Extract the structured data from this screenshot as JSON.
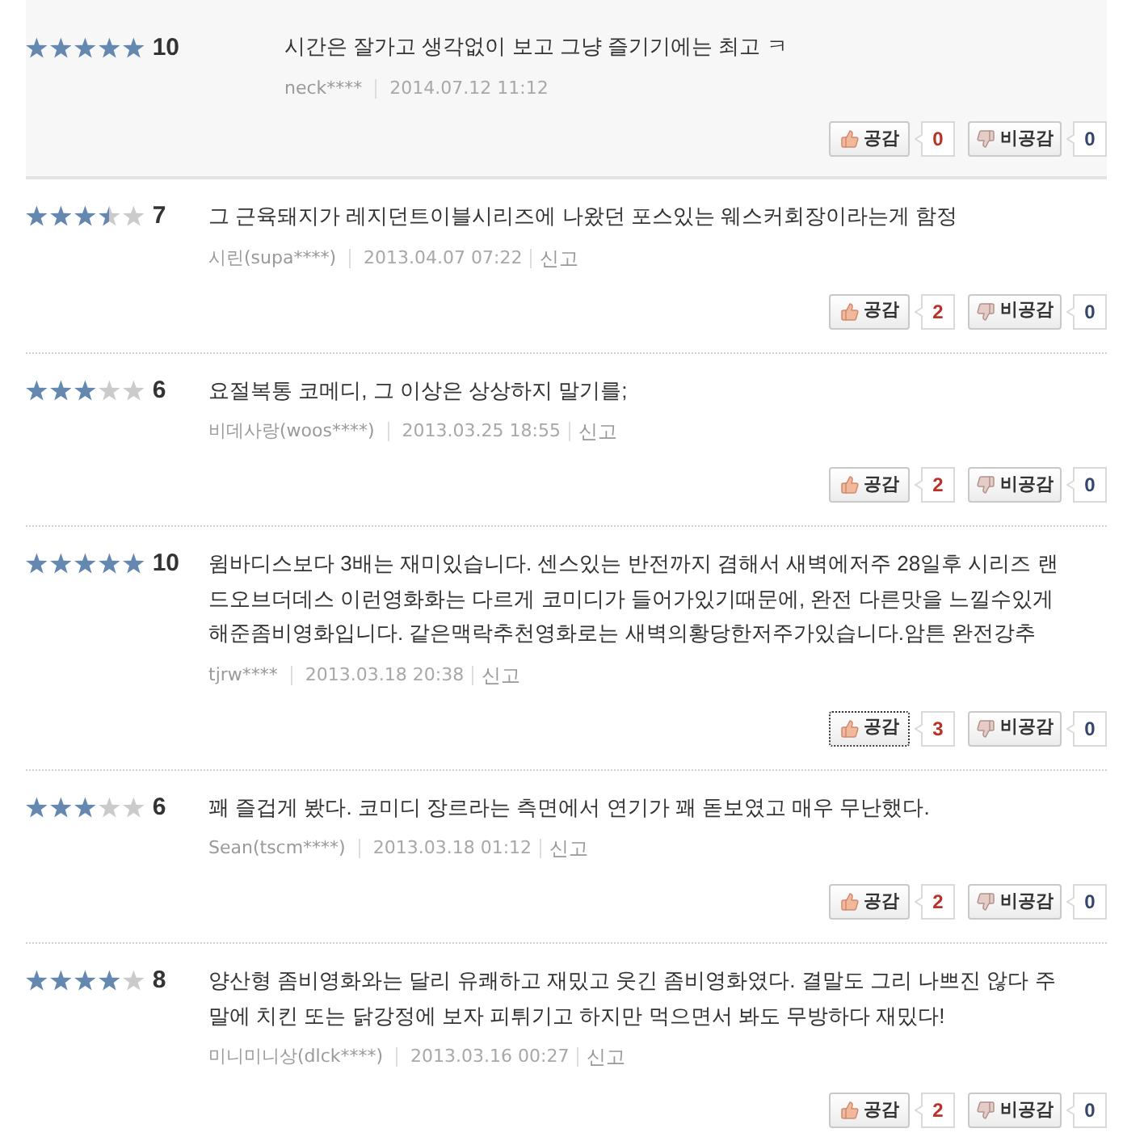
{
  "reviews": [
    {
      "highlighted": true,
      "stars": 5,
      "score": "10",
      "text": "시간은 잘가고 생각없이 보고 그냥 즐기기에는 최고 ㅋ",
      "author": "neck****",
      "date": "2014.07.12 11:12",
      "like": {
        "label": "공감",
        "count": "0",
        "focused": false
      },
      "dislike": {
        "label": "비공감",
        "count": "0"
      }
    },
    {
      "highlighted": false,
      "stars": 3.5,
      "score": "7",
      "text": "그 근육돼지가 레지던트이블시리즈에 나왔던 포스있는 웨스커회장이라는게 함정",
      "author": "시린(supa****)",
      "date": "2013.04.07 07:22",
      "report": "신고",
      "like": {
        "label": "공감",
        "count": "2",
        "focused": false
      },
      "dislike": {
        "label": "비공감",
        "count": "0"
      }
    },
    {
      "highlighted": false,
      "stars": 3,
      "score": "6",
      "text": "요절복통 코메디, 그 이상은 상상하지 말기를;",
      "author": "비데사랑(woos****)",
      "date": "2013.03.25 18:55",
      "report": "신고",
      "like": {
        "label": "공감",
        "count": "2",
        "focused": false
      },
      "dislike": {
        "label": "비공감",
        "count": "0"
      }
    },
    {
      "highlighted": false,
      "stars": 5,
      "score": "10",
      "text": "윔바디스보다 3배는 재미있습니다. 센스있는 반전까지 겸해서 새벽에저주 28일후 시리즈 랜드오브더데스 이런영화화는 다르게 코미디가 들어가있기때문에, 완전 다른맛을 느낄수있게 해준좀비영화입니다. 같은맥락추천영화로는 새벽의황당한저주가있습니다.암튼 완전강추",
      "author": "tjrw****",
      "date": "2013.03.18 20:38",
      "report": "신고",
      "like": {
        "label": "공감",
        "count": "3",
        "focused": true
      },
      "dislike": {
        "label": "비공감",
        "count": "0"
      }
    },
    {
      "highlighted": false,
      "stars": 3,
      "score": "6",
      "text": "꽤 즐겁게 봤다. 코미디 장르라는 측면에서 연기가 꽤 돋보였고 매우 무난했다.",
      "author": "Sean(tscm****)",
      "date": "2013.03.18 01:12",
      "report": "신고",
      "like": {
        "label": "공감",
        "count": "2",
        "focused": false
      },
      "dislike": {
        "label": "비공감",
        "count": "0"
      }
    },
    {
      "highlighted": false,
      "stars": 4,
      "score": "8",
      "text": "양산형 좀비영화와는 달리 유쾌하고 재밌고 웃긴 좀비영화였다. 결말도 그리 나쁘진 않다 주말에 치킨 또는 닭강정에 보자 피튀기고 하지만 먹으면서 봐도 무방하다 재밌다!",
      "author": "미니미니상(dlck****)",
      "date": "2013.03.16 00:27",
      "report": "신고",
      "like": {
        "label": "공감",
        "count": "2",
        "focused": false
      },
      "dislike": {
        "label": "비공감",
        "count": "0"
      }
    }
  ]
}
